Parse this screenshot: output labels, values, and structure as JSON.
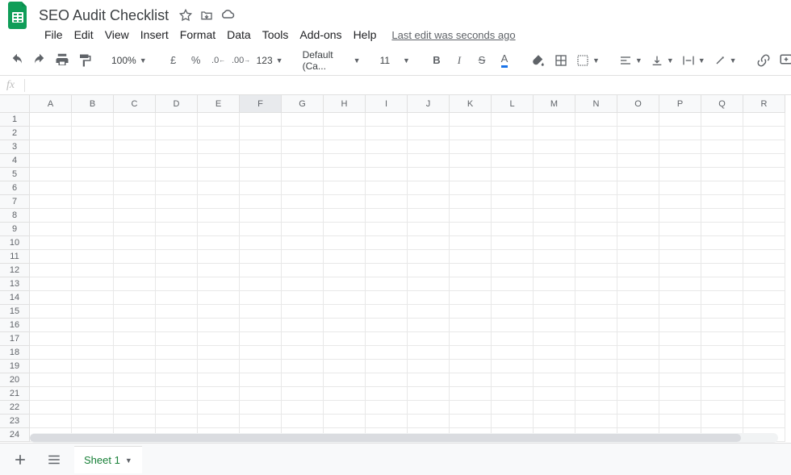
{
  "doc": {
    "title": "SEO Audit  Checklist"
  },
  "menu": {
    "file": "File",
    "edit": "Edit",
    "view": "View",
    "insert": "Insert",
    "format": "Format",
    "data": "Data",
    "tools": "Tools",
    "addons": "Add-ons",
    "help": "Help",
    "last_edit": "Last edit was seconds ago"
  },
  "toolbar": {
    "zoom": "100%",
    "currency": "£",
    "percent": "%",
    "dec_minus": ".0",
    "dec_plus": ".00",
    "more_formats": "123",
    "font": "Default (Ca...",
    "font_size": "11"
  },
  "grid": {
    "columns": [
      "A",
      "B",
      "C",
      "D",
      "E",
      "F",
      "G",
      "H",
      "I",
      "J",
      "K",
      "L",
      "M",
      "N",
      "O",
      "P",
      "Q",
      "R"
    ],
    "selected_col": "F",
    "rows": 24
  },
  "tabs": {
    "sheet1": "Sheet 1"
  }
}
